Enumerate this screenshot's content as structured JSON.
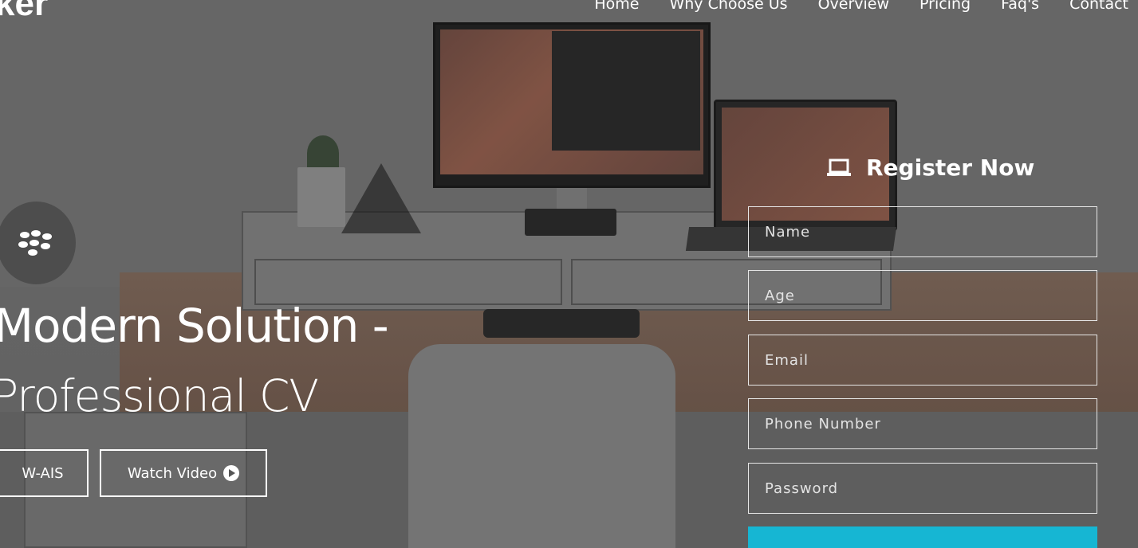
{
  "header": {
    "logo_text": "ker",
    "nav": [
      "Home",
      "Why Choose Us",
      "Overview",
      "Pricing",
      "Faq's",
      "Contact"
    ]
  },
  "hero": {
    "brand_icon": "blackberry-icon",
    "headline": "Modern Solution -",
    "subheadline": "Professional CV",
    "primary_button": "W-AIS",
    "secondary_button": "Watch Video",
    "secondary_button_icon": "play-circle-icon"
  },
  "register": {
    "title": "Register Now",
    "title_icon": "laptop-icon",
    "fields": {
      "name": "Name",
      "age": "Age",
      "email": "Email",
      "phone": "Phone Number",
      "password": "Password"
    },
    "submit_color": "#16b6d3"
  }
}
